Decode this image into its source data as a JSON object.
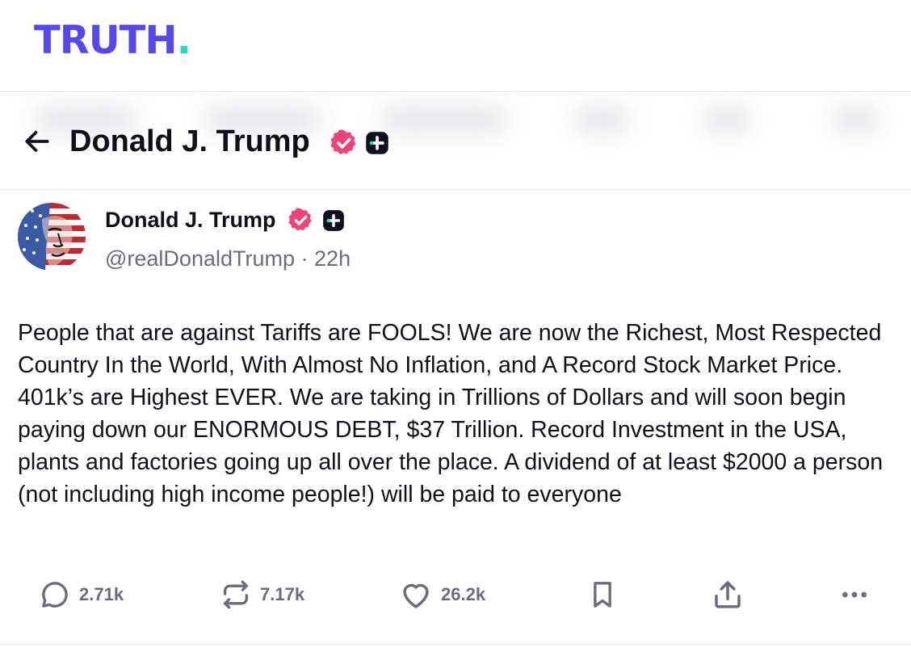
{
  "brand": {
    "logo_text": "TRUTH",
    "logo_dot": ".",
    "primary_color": "#5448ee",
    "accent_color": "#17e2c0"
  },
  "header": {
    "title": "Donald J. Trump",
    "back_icon": "arrow-left-icon"
  },
  "post": {
    "author": {
      "name": "Donald J. Trump",
      "handle": "@realDonaldTrump",
      "separator": "·",
      "time": "22h",
      "verified_color": "#f0437a"
    },
    "text": "People that are against Tariffs are FOOLS! We are now the Richest, Most Respected Country In the World, With Almost No Inflation, and A Record Stock Market Price. 401k’s are Highest EVER. We are taking in Trillions of Dollars and will soon begin paying down our ENORMOUS DEBT, $37 Trillion. Record Investment in the USA, plants and factories going up all over the place. A dividend of at least $2000 a person (not including high income people!) will be paid to everyone",
    "stats": {
      "replies": "2.71k",
      "retruths": "7.17k",
      "likes": "26.2k"
    }
  }
}
